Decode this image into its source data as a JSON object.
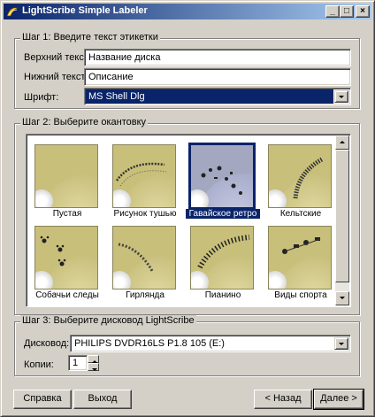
{
  "window": {
    "title": "LightScribe Simple Labeler",
    "controls": [
      "_",
      "□",
      "×"
    ]
  },
  "step1": {
    "title": "Шаг 1: Введите текст этикетки",
    "top_label": "Верхний текст:",
    "top_value": "Название диска",
    "bottom_label": "Нижний текст:",
    "bottom_value": "Описание",
    "font_label": "Шрифт:",
    "font_value": "MS Shell Dlg"
  },
  "step2": {
    "title": "Шаг 2: Выберите окантовку",
    "items": [
      {
        "label": "Пустая",
        "selected": false
      },
      {
        "label": "Рисунок тушью",
        "selected": false
      },
      {
        "label": "Гавайское ретро",
        "selected": true
      },
      {
        "label": "Кельтские",
        "selected": false
      },
      {
        "label": "Собачьи следы",
        "selected": false
      },
      {
        "label": "Гирлянда",
        "selected": false
      },
      {
        "label": "Пианино",
        "selected": false
      },
      {
        "label": "Виды спорта",
        "selected": false
      }
    ]
  },
  "step3": {
    "title": "Шаг 3: Выберите дисковод LightScribe",
    "drive_label": "Дисковод:",
    "drive_value": "PHILIPS DVDR16LS P1.8 105 (E:)",
    "copies_label": "Копии:",
    "copies_value": "1"
  },
  "buttons": {
    "help": "Справка",
    "exit": "Выход",
    "back": "< Назад",
    "next": "Далее >"
  }
}
